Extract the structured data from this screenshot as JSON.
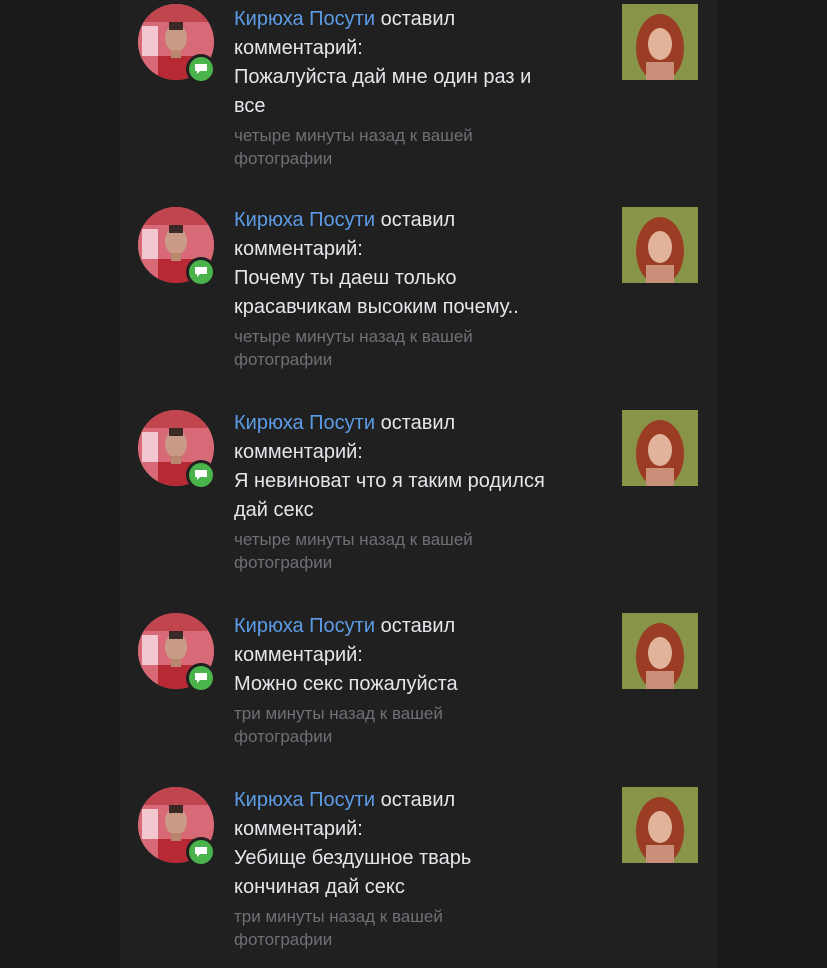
{
  "colors": {
    "background": "#19191a",
    "feed_background": "#202021",
    "author_link": "#5c9ce6",
    "text": "#e4e6ea",
    "meta_text": "#6d7075",
    "badge": "#4bb34b"
  },
  "notifications": [
    {
      "author": "Кирюха Посути",
      "action": " оставил",
      "line2": "комментарий:",
      "comment_lines": [
        "Пожалуйста дай мне один раз и",
        "все"
      ],
      "meta_lines": [
        "четыре минуты назад к вашей",
        "фотографии"
      ],
      "badge_icon": "comment-icon"
    },
    {
      "author": "Кирюха Посути",
      "action": " оставил",
      "line2": "комментарий:",
      "comment_lines": [
        "Почему ты даеш только",
        "красавчикам высоким почему.."
      ],
      "meta_lines": [
        "четыре минуты назад к вашей",
        "фотографии"
      ],
      "badge_icon": "comment-icon"
    },
    {
      "author": "Кирюха Посути",
      "action": " оставил",
      "line2": "комментарий:",
      "comment_lines": [
        "Я невиноват что я таким родился",
        "дай секс"
      ],
      "meta_lines": [
        "четыре минуты назад к вашей",
        "фотографии"
      ],
      "badge_icon": "comment-icon"
    },
    {
      "author": "Кирюха Посути",
      "action": " оставил",
      "line2": "комментарий:",
      "comment_lines": [
        "Можно секс пожалуйста"
      ],
      "meta_lines": [
        "три минуты назад к вашей",
        "фотографии"
      ],
      "badge_icon": "comment-icon"
    },
    {
      "author": "Кирюха Посути",
      "action": " оставил",
      "line2": "комментарий:",
      "comment_lines": [
        "Уебище бездушное тварь",
        "кончиная дай секс"
      ],
      "meta_lines": [
        "три минуты назад к вашей",
        "фотографии"
      ],
      "badge_icon": "comment-icon"
    }
  ]
}
